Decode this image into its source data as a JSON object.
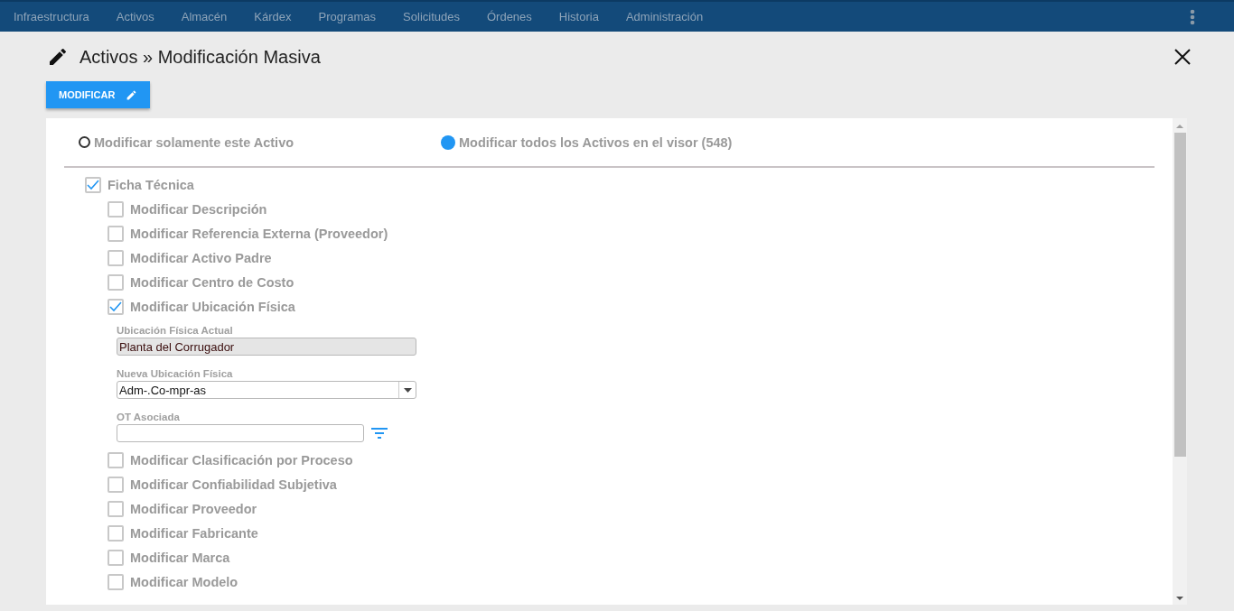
{
  "nav": {
    "items": [
      {
        "label": "Infraestructura"
      },
      {
        "label": "Activos"
      },
      {
        "label": "Almacén"
      },
      {
        "label": "Kárdex"
      },
      {
        "label": "Programas"
      },
      {
        "label": "Solicitudes"
      },
      {
        "label": "Órdenes"
      },
      {
        "label": "Historia"
      },
      {
        "label": "Administración"
      }
    ]
  },
  "header": {
    "title": "Activos » Modificación Masiva",
    "button": "MODIFICAR"
  },
  "scope": [
    {
      "label": "Modificar solamente este Activo",
      "selected": false
    },
    {
      "label": "Modificar todos los Activos en el visor (548)",
      "selected": true
    }
  ],
  "section": {
    "label": "Ficha Técnica",
    "checked": true,
    "children": [
      {
        "label": "Modificar Descripción",
        "checked": false
      },
      {
        "label": "Modificar Referencia Externa (Proveedor)",
        "checked": false
      },
      {
        "label": "Modificar Activo Padre",
        "checked": false
      },
      {
        "label": "Modificar Centro de Costo",
        "checked": false
      },
      {
        "label": "Modificar Ubicación Física",
        "checked": true,
        "fields": [
          {
            "kind": "readonly",
            "label": "Ubicación Física Actual",
            "value": "Planta del Corrugador"
          },
          {
            "kind": "select",
            "label": "Nueva Ubicación Física",
            "value": "Adm-.Co-mpr-as"
          },
          {
            "kind": "lookup",
            "label": "OT Asociada"
          }
        ]
      },
      {
        "label": "Modificar Clasificación por Proceso",
        "checked": false
      },
      {
        "label": "Modificar Confiabilidad Subjetiva",
        "checked": false
      },
      {
        "label": "Modificar Proveedor",
        "checked": false
      },
      {
        "label": "Modificar Fabricante",
        "checked": false
      },
      {
        "label": "Modificar Marca",
        "checked": false
      },
      {
        "label": "Modificar Modelo",
        "checked": false
      }
    ]
  }
}
